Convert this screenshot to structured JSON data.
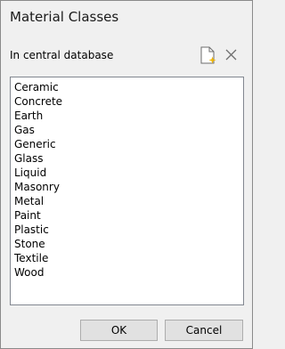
{
  "window": {
    "title": "Material Classes"
  },
  "section": {
    "label": "In central database"
  },
  "toolbar": {
    "new_icon": "new-document-icon",
    "delete_icon": "close-x-icon"
  },
  "list": {
    "items": [
      "Ceramic",
      "Concrete",
      "Earth",
      "Gas",
      "Generic",
      "Glass",
      "Liquid",
      "Masonry",
      "Metal",
      "Paint",
      "Plastic",
      "Stone",
      "Textile",
      "Wood"
    ]
  },
  "buttons": {
    "ok": "OK",
    "cancel": "Cancel"
  },
  "colors": {
    "new_icon_accent": "#f2b705",
    "icon_gray": "#6d6d6d"
  }
}
